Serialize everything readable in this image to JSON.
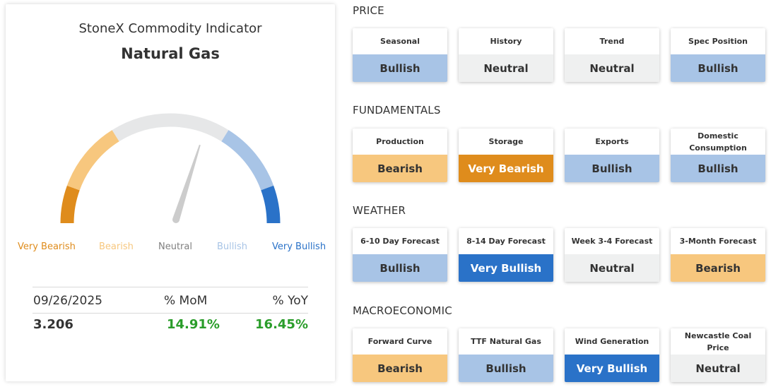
{
  "gauge": {
    "subtitle": "StoneX Commodity Indicator",
    "commodity": "Natural Gas",
    "needle_value": 0.28,
    "scale": {
      "min": -1,
      "max": 1
    },
    "labels": [
      {
        "text": "Very Bearish",
        "color": "#df8c1c"
      },
      {
        "text": "Bearish",
        "color": "#f7c77e"
      },
      {
        "text": "Neutral",
        "color": "#808080"
      },
      {
        "text": "Bullish",
        "color": "#a8c4e6"
      },
      {
        "text": "Very Bullish",
        "color": "#2a72c8"
      }
    ],
    "colors": {
      "very_bearish": "#df8c1c",
      "bearish": "#f7c77e",
      "neutral": "#e6e7e8",
      "bullish": "#a8c4e6",
      "very_bullish": "#2a72c8",
      "needle": "#cccccc"
    }
  },
  "stats": {
    "date": "09/26/2025",
    "mom_label": "% MoM",
    "yoy_label": "% YoY",
    "price": "3.206",
    "mom": "14.91%",
    "yoy": "16.45%",
    "positive_color": "#2a9d2a"
  },
  "sections": [
    {
      "title": "PRICE",
      "tiles": [
        {
          "label": "Seasonal",
          "value": "Bullish",
          "status": "bullish"
        },
        {
          "label": "History",
          "value": "Neutral",
          "status": "neutral"
        },
        {
          "label": "Trend",
          "value": "Neutral",
          "status": "neutral"
        },
        {
          "label": "Spec Position",
          "value": "Bullish",
          "status": "bullish"
        }
      ]
    },
    {
      "title": "FUNDAMENTALS",
      "tiles": [
        {
          "label": "Production",
          "value": "Bearish",
          "status": "bearish"
        },
        {
          "label": "Storage",
          "value": "Very Bearish",
          "status": "very-bearish"
        },
        {
          "label": "Exports",
          "value": "Bullish",
          "status": "bullish"
        },
        {
          "label": "Domestic Consumption",
          "value": "Bullish",
          "status": "bullish"
        }
      ]
    },
    {
      "title": "WEATHER",
      "tiles": [
        {
          "label": "6-10 Day Forecast",
          "value": "Bullish",
          "status": "bullish"
        },
        {
          "label": "8-14 Day Forecast",
          "value": "Very Bullish",
          "status": "very-bullish"
        },
        {
          "label": "Week 3-4 Forecast",
          "value": "Neutral",
          "status": "neutral"
        },
        {
          "label": "3-Month Forecast",
          "value": "Bearish",
          "status": "bearish"
        }
      ]
    },
    {
      "title": "MACROECONOMIC",
      "tiles": [
        {
          "label": "Forward Curve",
          "value": "Bearish",
          "status": "bearish"
        },
        {
          "label": "TTF Natural Gas",
          "value": "Bullish",
          "status": "bullish"
        },
        {
          "label": "Wind Generation",
          "value": "Very Bullish",
          "status": "very-bullish"
        },
        {
          "label": "Newcastle Coal Price",
          "value": "Neutral",
          "status": "neutral"
        }
      ]
    }
  ]
}
